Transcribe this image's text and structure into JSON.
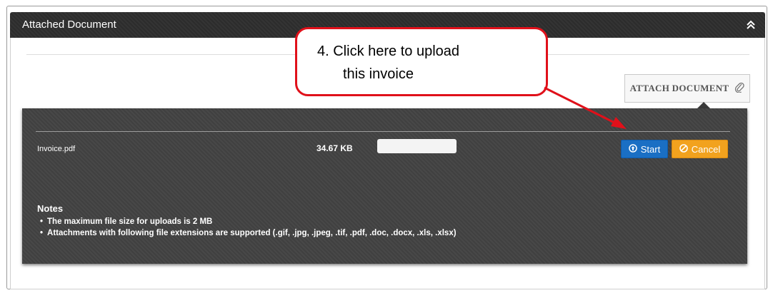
{
  "panel": {
    "title": "Attached Document"
  },
  "attach_button": {
    "label": "ATTACH DOCUMENT"
  },
  "upload": {
    "file_name": "Invoice.pdf",
    "file_size": "34.67 KB",
    "progress_fraction": 0,
    "start_label": "Start",
    "cancel_label": "Cancel"
  },
  "notes": {
    "title": "Notes",
    "items": [
      "The maximum file size for uploads is 2 MB",
      "Attachments with following file extensions are supported (.gif, .jpg, .jpeg, .tif, .pdf, .doc, .docx, .xls, .xlsx)"
    ]
  },
  "callout": {
    "line1": "4. Click here to upload",
    "line2": "this invoice"
  },
  "colors": {
    "callout_border": "#e0101a",
    "start_button": "#1a6fc4",
    "cancel_button": "#f2a21e",
    "header_bg": "#2c2c2c"
  }
}
